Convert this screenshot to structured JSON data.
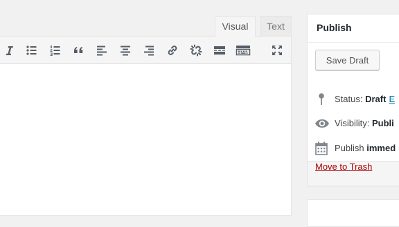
{
  "editor": {
    "tabs": [
      {
        "label": "Visual",
        "active": true
      },
      {
        "label": "Text",
        "active": false
      }
    ],
    "toolbar": [
      {
        "name": "italic",
        "icon": "italic-icon"
      },
      {
        "name": "bulleted-list",
        "icon": "bulleted-list-icon"
      },
      {
        "name": "numbered-list",
        "icon": "numbered-list-icon"
      },
      {
        "name": "blockquote",
        "icon": "blockquote-icon"
      },
      {
        "name": "align-left",
        "icon": "align-left-icon"
      },
      {
        "name": "align-center",
        "icon": "align-center-icon"
      },
      {
        "name": "align-right",
        "icon": "align-right-icon"
      },
      {
        "name": "insert-link",
        "icon": "link-icon"
      },
      {
        "name": "remove-link",
        "icon": "unlink-icon"
      },
      {
        "name": "read-more",
        "icon": "read-more-icon"
      },
      {
        "name": "toolbar-toggle",
        "icon": "keyboard-icon"
      },
      {
        "name": "fullscreen",
        "icon": "fullscreen-icon"
      }
    ]
  },
  "publish": {
    "title": "Publish",
    "save_draft": "Save Draft",
    "status": {
      "label": "Status:",
      "value": "Draft",
      "edit": "E",
      "icon": "pin-icon"
    },
    "visibility": {
      "label": "Visibility:",
      "value": "Publi",
      "icon": "eye-icon"
    },
    "schedule": {
      "label": "Publish",
      "value": "immed",
      "icon": "calendar-icon"
    },
    "trash_link": "Move to Trash"
  },
  "colors": {
    "link": "#0073aa",
    "trash": "#aa0000",
    "icon": "#555d66",
    "panel_bg": "#f1f1f1"
  }
}
